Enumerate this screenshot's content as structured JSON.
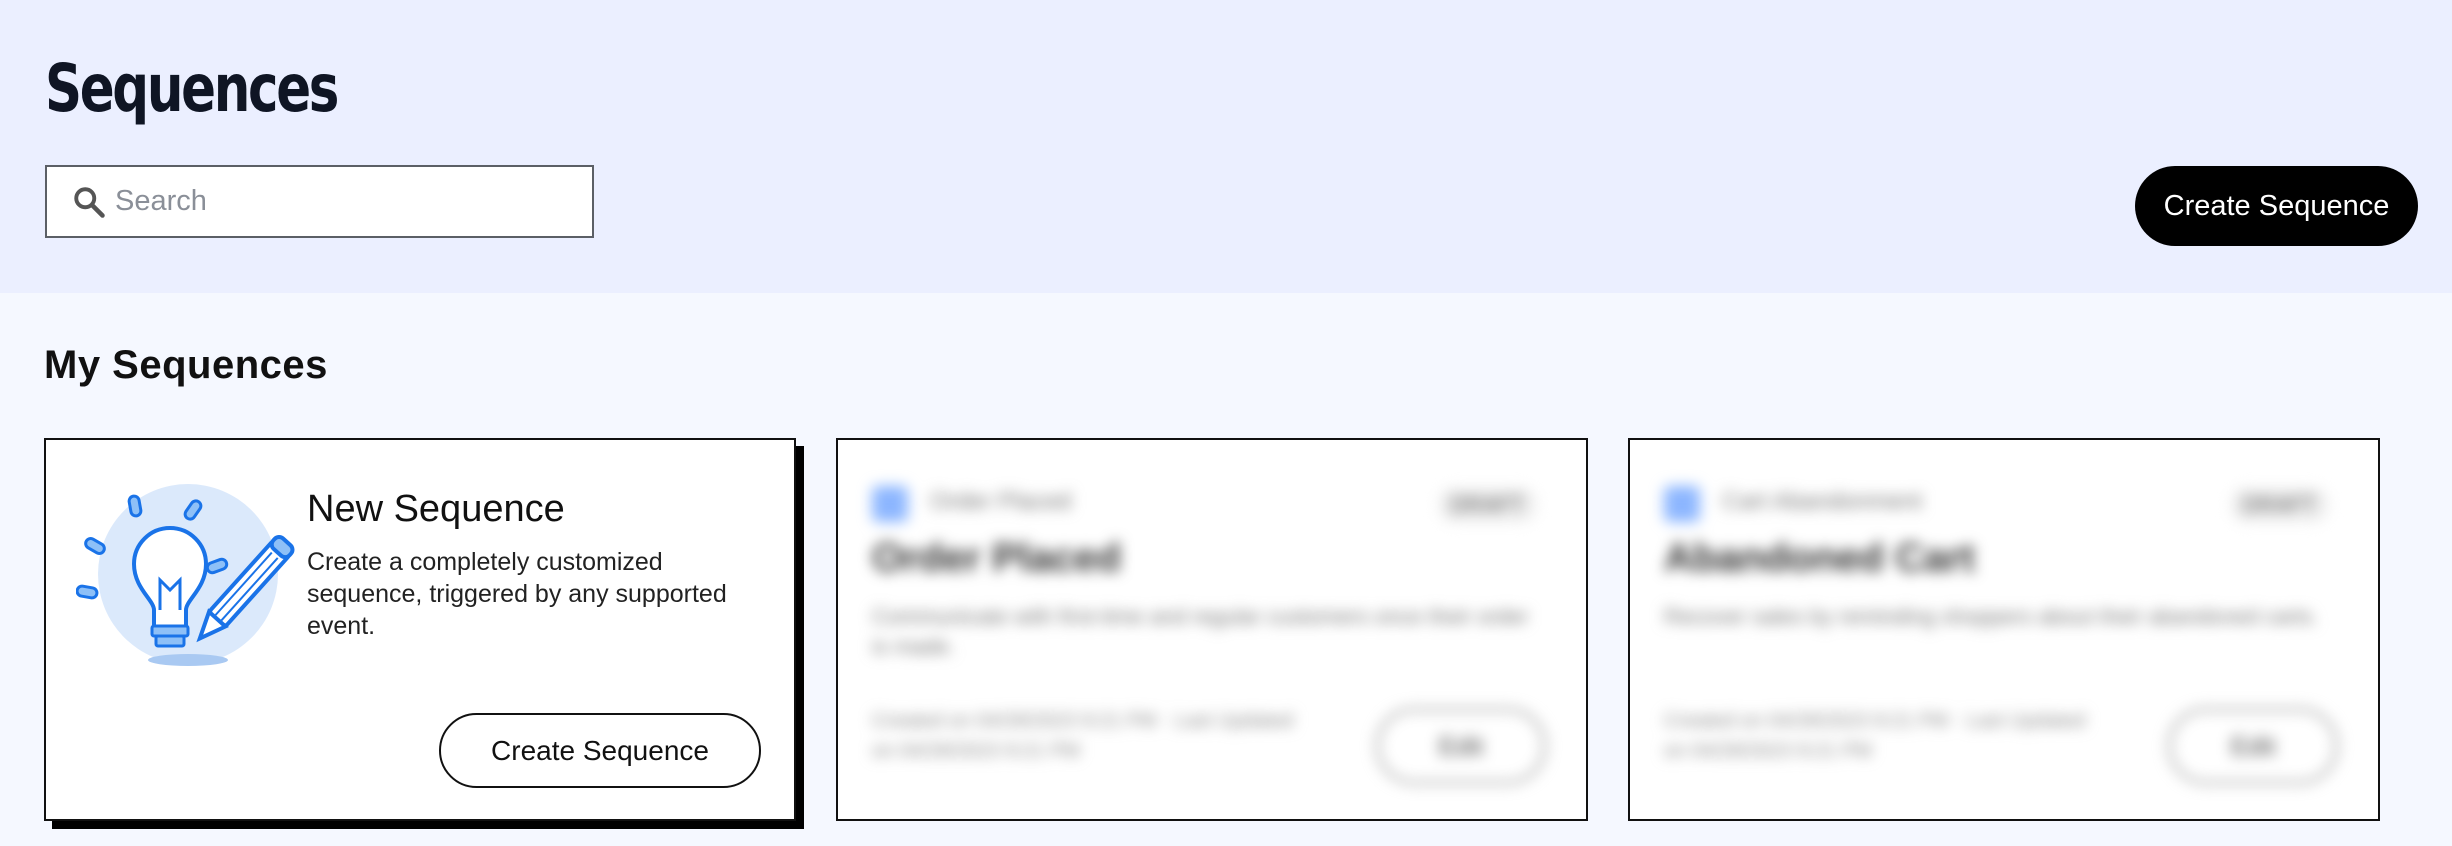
{
  "header": {
    "title": "Sequences",
    "search_placeholder": "Search",
    "create_label": "Create Sequence"
  },
  "main": {
    "section_title": "My Sequences",
    "new_card": {
      "title": "New Sequence",
      "description": "Create a completely customized sequence, triggered by any supported event.",
      "create_label": "Create Sequence",
      "illustration": "lightbulb-pencil-icon"
    },
    "blurred_cards": [
      {
        "tag": "Order Placed",
        "badge": "DRAFT",
        "title": "Order Placed",
        "description": "Communicate with first-time and regular customers once their order is made.",
        "stats": "Created on 04/28/2023 9:21 PM · Last Updated on 04/28/2023 9:21 PM",
        "button": "Edit"
      },
      {
        "tag": "Cart Abandonment",
        "badge": "DRAFT",
        "title": "Abandoned Cart",
        "description": "Recover sales by reminding shoppers about their abandoned carts.",
        "stats": "Created on 04/28/2023 9:21 PM · Last Updated on 04/28/2023 9:21 PM",
        "button": "Edit"
      }
    ]
  },
  "colors": {
    "header_bg": "#ebefff",
    "page_bg": "#f5f8ff",
    "accent_blue": "#1a73e8",
    "button_dark": "#000000"
  }
}
